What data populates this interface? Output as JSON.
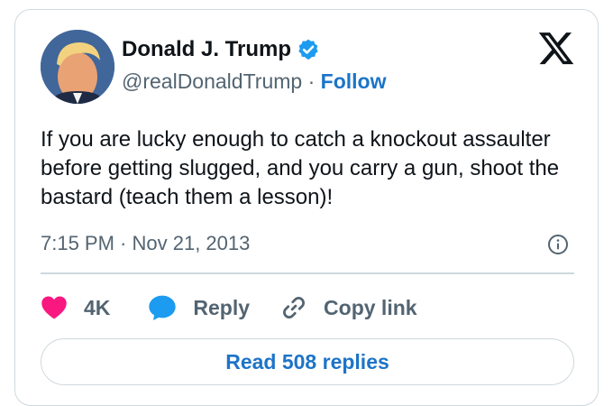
{
  "author": {
    "display_name": "Donald J. Trump",
    "handle": "@realDonaldTrump",
    "separator": " · ",
    "follow_label": "Follow",
    "verified": true
  },
  "tweet": {
    "text": "If you are lucky enough to catch a knockout assaulter before getting slugged, and you carry a gun, shoot the bastard (teach them a lesson)!",
    "timestamp": "7:15 PM · Nov 21, 2013"
  },
  "actions": {
    "like_count": "4K",
    "reply_label": "Reply",
    "copy_link_label": "Copy link"
  },
  "footer": {
    "read_replies_label": "Read 508 replies"
  },
  "colors": {
    "like": "#f91880",
    "reply": "#1d9bf0",
    "link": "#1d74c8",
    "verified": "#1d9bf0",
    "secondary_text": "#536471",
    "border": "#cfd9de"
  },
  "icons": {
    "brand": "x-logo-icon",
    "verified": "verified-badge-icon",
    "info": "info-icon",
    "like": "heart-icon",
    "reply": "speech-bubble-icon",
    "copy_link": "link-icon"
  }
}
